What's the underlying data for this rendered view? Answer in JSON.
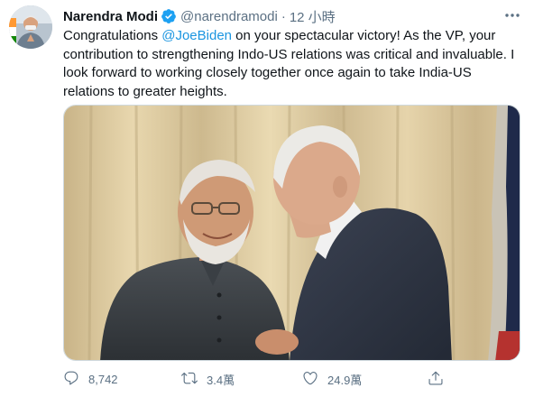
{
  "tweet": {
    "author": {
      "name": "Narendra Modi",
      "handle": "@narendramodi",
      "verified": true
    },
    "separator": "·",
    "timestamp": "12 小時",
    "more_icon": "more-dots-icon",
    "text": {
      "part1": "Congratulations ",
      "mention": "@JoeBiden",
      "part2": " on your spectacular victory! As the VP, your contribution to strengthening Indo-US relations was critical and invaluable. I look forward to working closely together once again to take India-US relations to greater heights."
    },
    "actions": {
      "reply": {
        "icon": "reply-icon",
        "count": "8,742"
      },
      "retweet": {
        "icon": "retweet-icon",
        "count": "3.4萬"
      },
      "like": {
        "icon": "heart-icon",
        "count": "24.9萬"
      },
      "share": {
        "icon": "share-icon"
      }
    }
  },
  "colors": {
    "text": "#0f1419",
    "secondary": "#5b7083",
    "link": "#1b95e0",
    "verified": "#1da1f2"
  }
}
